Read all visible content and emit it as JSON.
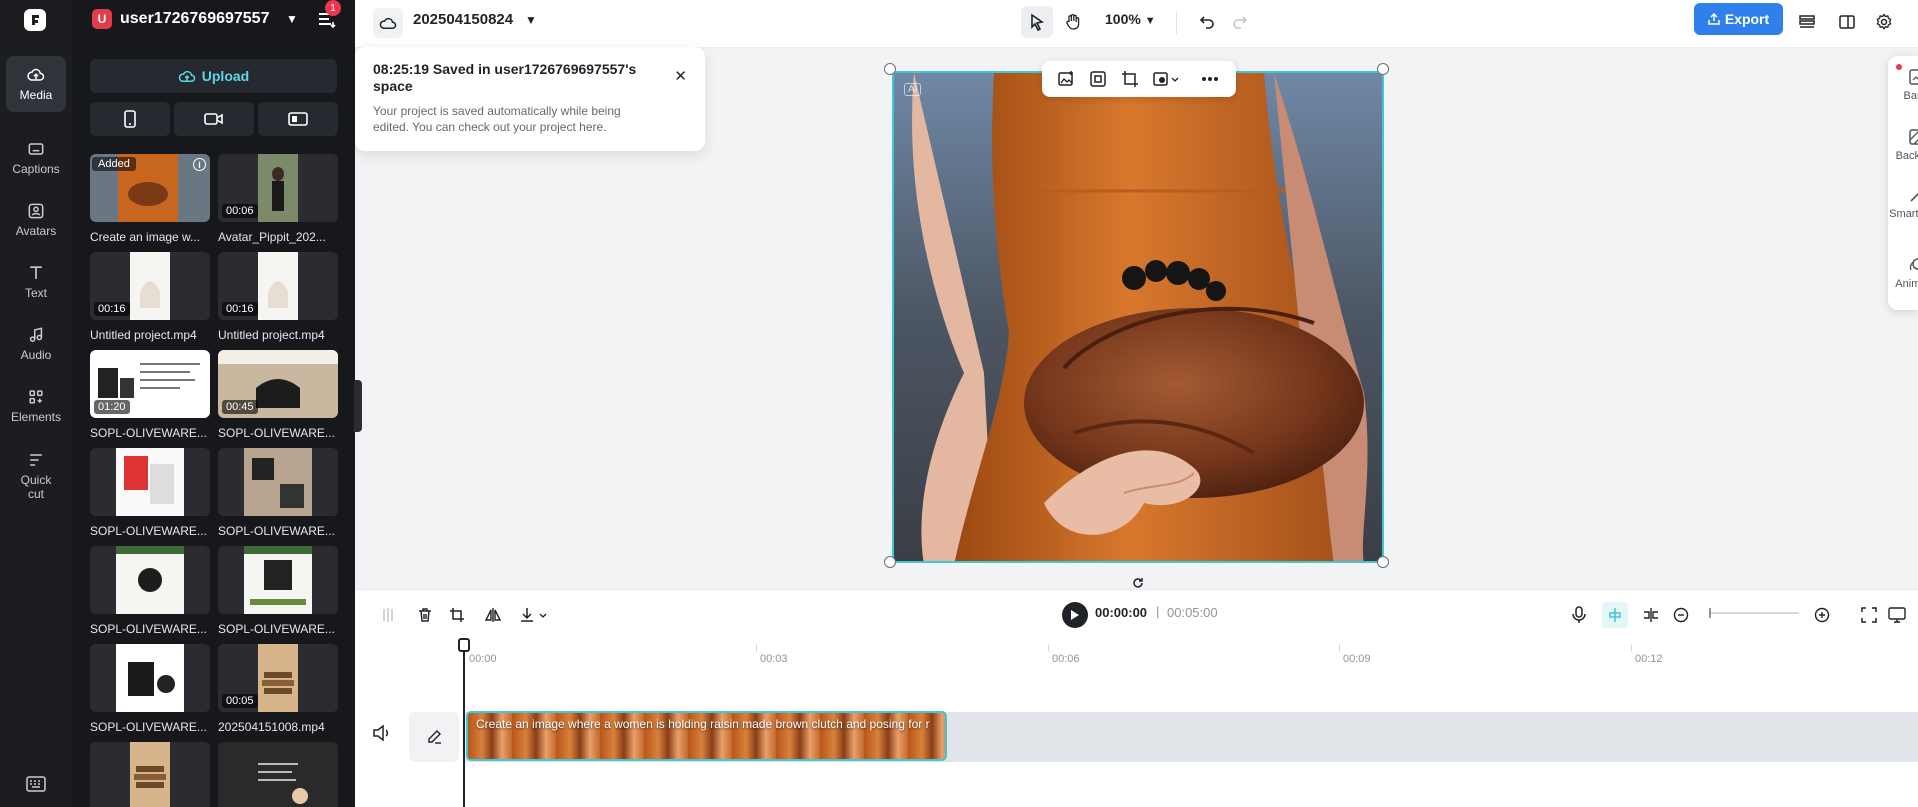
{
  "rail": {
    "items": [
      {
        "label": "Media",
        "icon": "cloud-icon",
        "active": true
      },
      {
        "label": "Captions",
        "icon": "captions-icon"
      },
      {
        "label": "Avatars",
        "icon": "avatar-icon"
      },
      {
        "label": "Text",
        "icon": "text-icon"
      },
      {
        "label": "Audio",
        "icon": "music-icon"
      },
      {
        "label": "Elements",
        "icon": "elements-icon"
      },
      {
        "label": "Quick cut",
        "icon": "quick-cut-icon"
      }
    ]
  },
  "account": {
    "initial": "U",
    "name": "user1726769697557",
    "notifications": "1"
  },
  "media": {
    "upload_label": "Upload",
    "tiles": [
      {
        "label": "Create an image w...",
        "duration": "",
        "added": "Added"
      },
      {
        "label": "Avatar_Pippit_202...",
        "duration": "00:06"
      },
      {
        "label": "Untitled project.mp4",
        "duration": "00:16"
      },
      {
        "label": "Untitled project.mp4",
        "duration": "00:16"
      },
      {
        "label": "SOPL-OLIVEWARE...",
        "duration": "01:20"
      },
      {
        "label": "SOPL-OLIVEWARE...",
        "duration": "00:45"
      },
      {
        "label": "SOPL-OLIVEWARE...",
        "duration": ""
      },
      {
        "label": "SOPL-OLIVEWARE...",
        "duration": ""
      },
      {
        "label": "SOPL-OLIVEWARE...",
        "duration": ""
      },
      {
        "label": "SOPL-OLIVEWARE...",
        "duration": ""
      },
      {
        "label": "SOPL-OLIVEWARE...",
        "duration": ""
      },
      {
        "label": "202504151008.mp4",
        "duration": "00:05"
      },
      {
        "label": "",
        "duration": ""
      },
      {
        "label": "",
        "duration": ""
      }
    ],
    "tile_text": {
      "reading": "READING",
      "customer": "CUSTOMER SATISFACTION"
    }
  },
  "topbar": {
    "project_name": "202504150824",
    "zoom": "100%",
    "export_label": "Export"
  },
  "toast": {
    "title": "08:25:19 Saved in user1726769697557's space",
    "body": "Your project is saved automatically while being edited. You can check out your project here."
  },
  "canvas": {
    "ai_mark": "AI"
  },
  "right_panel": {
    "items": [
      {
        "label": "Basic",
        "icon": "basic-icon"
      },
      {
        "label": "Backgr...",
        "icon": "background-icon"
      },
      {
        "label": "Smart tools",
        "icon": "magic-wand-icon"
      },
      {
        "label": "Animat...",
        "icon": "animation-icon"
      }
    ]
  },
  "timeline": {
    "current_time": "00:00:00",
    "separator": "|",
    "total_time": "00:05:00",
    "ruler": [
      "00:00",
      "00:03",
      "00:06",
      "00:09",
      "00:12"
    ],
    "clip_text": "Create an image where a women is holding raisin made brown clutch and posing for r"
  },
  "colors": {
    "accent": "#3ec7d6",
    "export": "#2f80ed",
    "panel": "#17181c",
    "rail": "#1c1d21"
  }
}
